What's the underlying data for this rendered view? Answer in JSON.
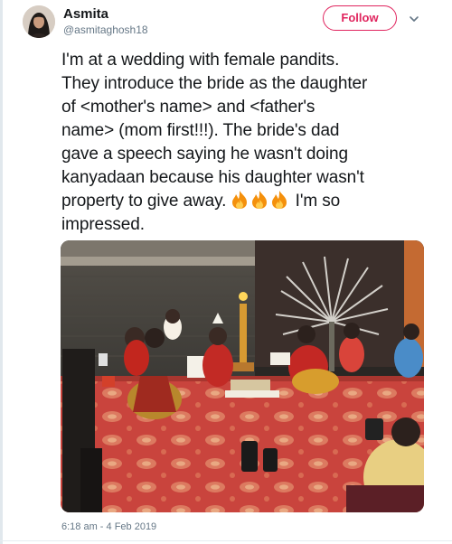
{
  "author": {
    "display_name": "Asmita",
    "handle": "@asmitaghosh18"
  },
  "follow_button": {
    "label": "Follow"
  },
  "tweet": {
    "lines": [
      "I'm at a wedding with female pandits.",
      "They introduce the bride as the daughter",
      "of <mother's name> and <father's",
      "name> (mom first!!!). The bride's dad",
      "gave a speech saying he wasn't doing",
      "kanyadaan because his daughter wasn't",
      "property to give away.",
      "I'm so",
      "impressed."
    ],
    "emoji": [
      "fire",
      "fire",
      "fire"
    ],
    "timestamp": "6:18 am - 4 Feb 2019"
  },
  "colors": {
    "follow_accent": "#e0245e",
    "text_primary": "#14171a",
    "text_secondary": "#657786"
  },
  "icons": {
    "caret": "chevron-down-icon",
    "emoji": "fire-emoji-icon"
  }
}
